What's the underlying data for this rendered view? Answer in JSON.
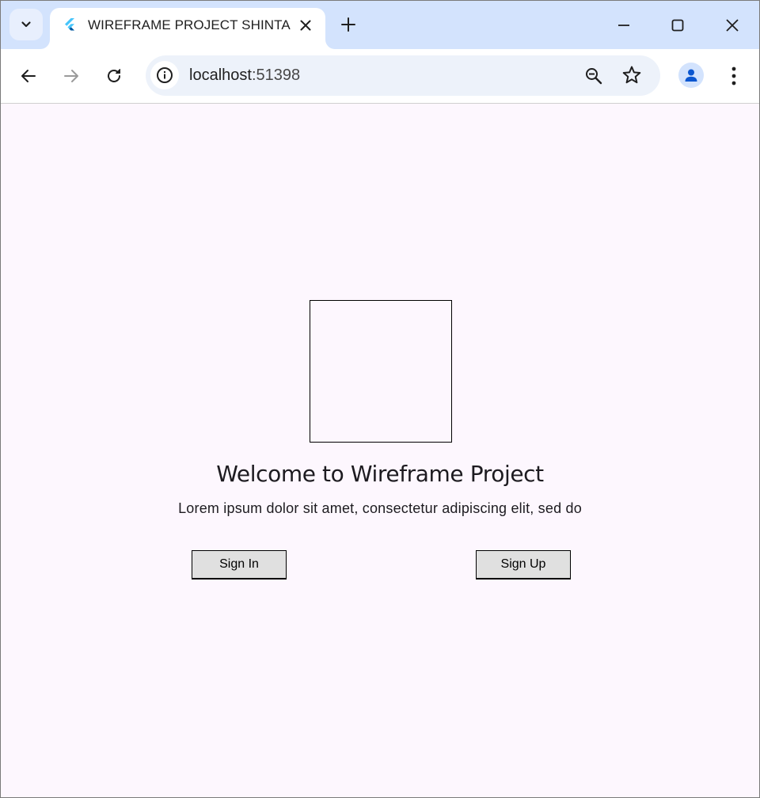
{
  "browser": {
    "tab": {
      "title": "WIREFRAME PROJECT SHINTA",
      "favicon": "flutter-icon"
    },
    "address_bar": {
      "host": "localhost",
      "port": ":51398"
    },
    "colors": {
      "tabstrip": "#d3e3fd",
      "omnibox": "#edf2fa",
      "page_background": "#fdf7fe"
    }
  },
  "page": {
    "welcome_title": "Welcome to Wireframe Project",
    "description": "Lorem ipsum dolor sit amet, consectetur adipiscing elit, sed do",
    "buttons": {
      "sign_in": "Sign In",
      "sign_up": "Sign Up"
    },
    "colors": {
      "button_background": "#e0e0e0",
      "text": "#1d1b20"
    }
  }
}
